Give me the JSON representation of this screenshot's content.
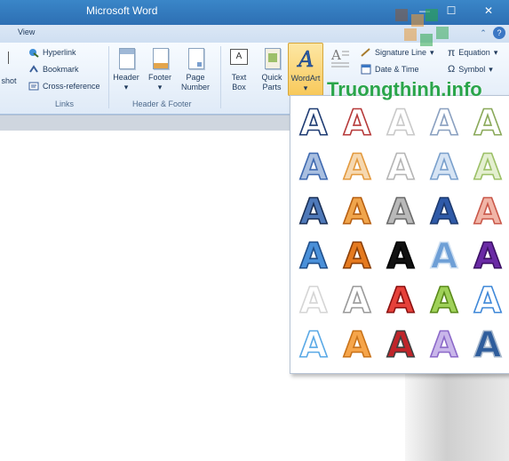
{
  "window": {
    "title": "Microsoft Word",
    "min": "—",
    "max": "☐",
    "close": "✕"
  },
  "tabs": {
    "view": "View",
    "caret": "⌃",
    "help": "?"
  },
  "ribbon": {
    "screenshot_fragment": "shot",
    "links": {
      "hyperlink": "Hyperlink",
      "bookmark": "Bookmark",
      "cross_reference": "Cross-reference",
      "group": "Links"
    },
    "header_footer": {
      "header": "Header",
      "footer": "Footer",
      "page": "Page",
      "number": "Number",
      "group": "Header & Footer"
    },
    "text": {
      "text": "Text",
      "box": "Box",
      "quick": "Quick",
      "parts": "Parts",
      "wordart": "WordArt",
      "caret": "▾"
    },
    "right": {
      "signature_line": "Signature Line",
      "date_time": "Date & Time",
      "equation": "Equation",
      "symbol": "Symbol",
      "caret": "▾"
    }
  },
  "gallery": {
    "letter": "A",
    "styles": [
      [
        "#ffffff|#1f3c73",
        "#ffffff|#b63a3a",
        "#ffffff|#c9c9c9",
        "#ffffff|#8aa0c0",
        "#ffffff|#8aa95a"
      ],
      [
        "#a9bfe0|#3f6ab0",
        "#f6d8b0|#e39a3f",
        "#ffffff|#b5b5b5",
        "#d6e4f4|#7aa0cc",
        "#e4efd0|#9cc067"
      ],
      [
        "#4f79b9|#1a2f55",
        "#f0a54c|#b75f11",
        "#b9b9b9|#6b6b6b",
        "#2f5aa8|#1d3a6e",
        "#f1b5a7|#c9584a"
      ],
      [
        "#4a90d9|#204f8a",
        "#e57a1f|#8a3f08",
        "#111111|#000000",
        "#6e9fd6|#cfe0f2",
        "#6a2aa5|#3b1064"
      ],
      [
        "#ffffff|#d5d5d5",
        "#ffffff|#9a9a9a",
        "#e6413a|#8a1010",
        "#9fd159|#5a8a1a",
        "#ffffff|#3f88d8"
      ],
      [
        "#ffffff|#5aa9e6",
        "#f6a54a|#c9731a",
        "#c0252a|#3f3f3f",
        "#c9b6ea|#8c69c9",
        "#2f5d9c|#a6b7cc"
      ]
    ]
  },
  "watermark": {
    "text": "Truongthinh.info"
  }
}
